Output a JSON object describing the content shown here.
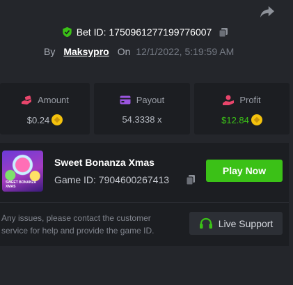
{
  "bet": {
    "id_label": "Bet ID: 1750961277199776007",
    "by_label": "By",
    "user": "Maksypro",
    "on_label": "On",
    "datetime": "12/1/2022, 5:19:59 AM"
  },
  "stats": [
    {
      "label": "Amount",
      "value": "$0.24",
      "value_color": "#b5b9c1",
      "icon_color": "#e8456b"
    },
    {
      "label": "Payout",
      "value": "54.3338 x",
      "value_color": "#b5b9c1",
      "icon_color": "#9b55e0"
    },
    {
      "label": "Profit",
      "value": "$12.84",
      "value_color": "#3bc117",
      "icon_color": "#e8456b"
    }
  ],
  "game": {
    "name": "Sweet Bonanza Xmas",
    "id_label": "Game ID: 7904600267413",
    "thumb_text": "SWEET BONANZA XMAS",
    "play_label": "Play Now"
  },
  "support": {
    "note": "Any issues, please contact the customer service for help and provide the game ID.",
    "button_label": "Live Support"
  },
  "colors": {
    "accent_green": "#3bc117",
    "shield_green": "#3bc117",
    "coin": "#f4c20d"
  }
}
